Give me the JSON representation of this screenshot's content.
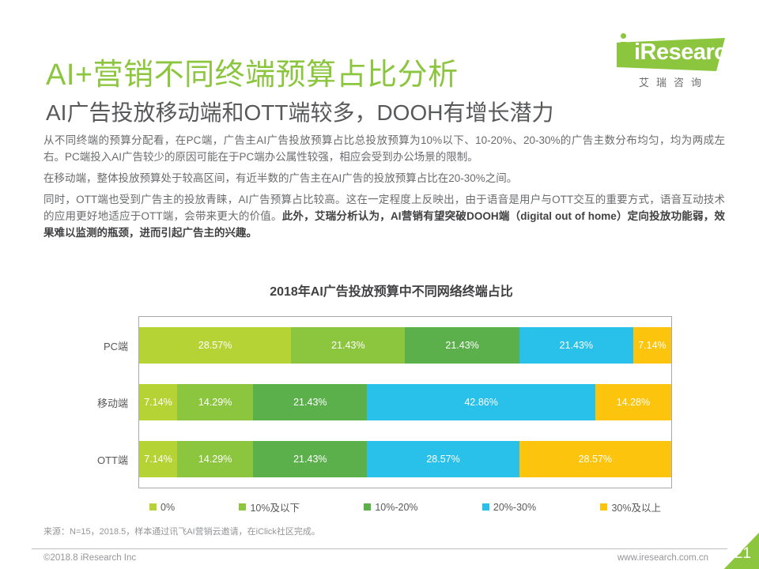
{
  "brand": {
    "logo_text": "iResearch",
    "logo_subtext": "艾瑞咨询",
    "accent_color": "#8cc63f"
  },
  "header": {
    "title": "AI+营销不同终端预算占比分析",
    "subtitle": "AI广告投放移动端和OTT端较多，DOOH有增长潜力"
  },
  "body": {
    "paragraph_1": "从不同终端的预算分配看，在PC端，广告主AI广告投放预算占比总投放预算为10%以下、10-20%、20-30%的广告主数分布均匀，均为两成左右。PC端投入AI广告较少的原因可能在于PC端办公属性较强，相应会受到办公场景的限制。",
    "paragraph_2": "在移动端，整体投放预算处于较高区间，有近半数的广告主在AI广告的投放预算占比在20-30%之间。",
    "paragraph_3_normal": "同时，OTT端也受到广告主的投放青睐，AI广告预算占比较高。这在一定程度上反映出，由于语音是用户与OTT交互的重要方式，语音互动技术的应用更好地适应于OTT端，会带来更大的价值。",
    "paragraph_3_bold": "此外，艾瑞分析认为，AI营销有望突破DOOH端（digital out of home）定向投放功能弱，效果难以监测的瓶颈，进而引起广告主的兴趣。"
  },
  "chart_data": {
    "type": "bar",
    "orientation": "horizontal",
    "stacked": "100%",
    "title": "2018年AI广告投放预算中不同网络终端占比",
    "xlabel": "",
    "ylabel": "",
    "grid": false,
    "legend_position": "bottom",
    "categories": [
      "PC端",
      "移动端",
      "OTT端"
    ],
    "series": [
      {
        "name": "0%",
        "color": "#b5d334",
        "values": [
          28.57,
          7.14,
          7.14
        ],
        "labels": [
          "28.57%",
          "7.14%",
          "7.14%"
        ]
      },
      {
        "name": "10%及以下",
        "color": "#8cc63f",
        "values": [
          21.43,
          14.29,
          14.29
        ],
        "labels": [
          "21.43%",
          "14.29%",
          "14.29%"
        ]
      },
      {
        "name": "10%-20%",
        "color": "#5cb04c",
        "values": [
          21.43,
          21.43,
          21.43
        ],
        "labels": [
          "21.43%",
          "21.43%",
          "21.43%"
        ]
      },
      {
        "name": "20%-30%",
        "color": "#29c0ea",
        "values": [
          21.43,
          42.86,
          28.57
        ],
        "labels": [
          "21.43%",
          "42.86%",
          "28.57%"
        ]
      },
      {
        "name": "30%及以上",
        "color": "#fcc40c",
        "values": [
          7.14,
          14.28,
          28.57
        ],
        "labels": [
          "7.14%",
          "14.28%",
          "28.57%"
        ]
      }
    ]
  },
  "source_note": "来源：N=15，2018.5，样本通过讯飞AI营销云邀请，在iClick社区完成。",
  "footer": {
    "copyright": "©2018.8 iResearch Inc",
    "website": "www.iresearch.com.cn",
    "page_number": "21"
  }
}
